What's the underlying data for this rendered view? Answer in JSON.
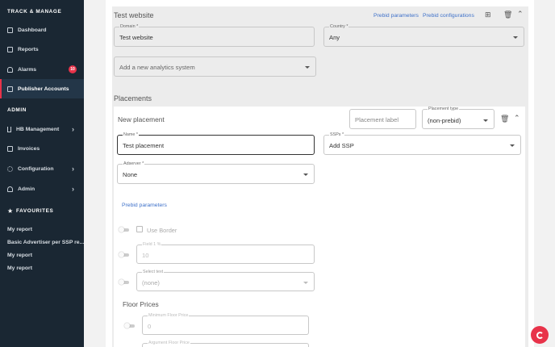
{
  "sidebar": {
    "section_track": "TRACK & MANAGE",
    "section_admin": "ADMIN",
    "section_favourites": "FAVOURITES",
    "items": {
      "dashboard": "Dashboard",
      "reports": "Reports",
      "alarms": "Alarms",
      "alarms_badge": "10",
      "publisher_accounts": "Publisher Accounts",
      "hb_management": "HB Management",
      "invoices": "Invoices",
      "configuration": "Configuration",
      "admin": "Admin"
    },
    "favourites": [
      "My report",
      "Basic Advertiser per SSP re...",
      "My report",
      "My report"
    ],
    "accent_color": "#e8334a"
  },
  "website": {
    "title": "Test website",
    "prebid_parameters_link": "Prebid parameters",
    "prebid_configurations_link": "Prebid configurations",
    "domain_label": "Domain *",
    "domain_value": "Test website",
    "country_label": "Country *",
    "country_value": "Any",
    "analytics_placeholder": "Add a new analytics system"
  },
  "placements": {
    "title": "Placements",
    "new_placement": {
      "title": "New placement",
      "placement_label_placeholder": "Placement label",
      "placement_type_label": "Placement type",
      "placement_type_value": "(non-prebid)",
      "name_label": "Name *",
      "name_value": "Test placement",
      "ssps_label": "SSPs *",
      "ssps_value": "Add SSP",
      "adserver_label": "Adserver *",
      "adserver_value": "None",
      "prebid_parameters_link": "Prebid parameters",
      "use_border_label": "Use Border",
      "fields": {
        "field1_label": "Field 1 %",
        "field1_value": "10",
        "select_label": "Select text",
        "select_value": "(none)"
      },
      "floor_prices": {
        "title": "Floor Prices",
        "minimum_label": "Minimum Floor Price",
        "minimum_value": "0",
        "argument_label": "Argument Floor Price"
      }
    }
  }
}
